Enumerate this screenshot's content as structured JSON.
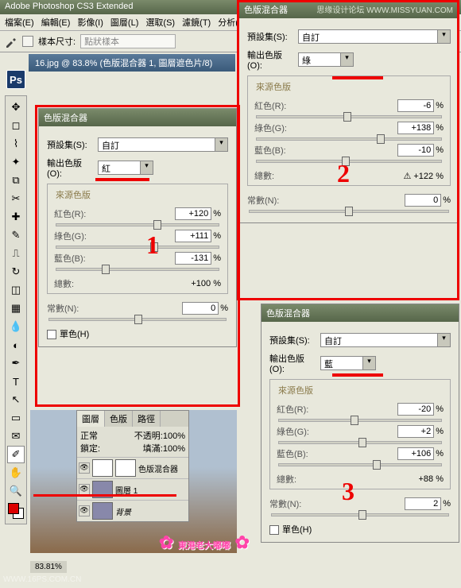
{
  "app": {
    "title": "Adobe Photoshop CS3 Extended"
  },
  "menu": {
    "file": "檔案(E)",
    "edit": "編輯(E)",
    "image": "影像(I)",
    "layer": "圖層(L)",
    "select": "選取(S)",
    "filter": "濾鏡(T)",
    "analysis": "分析(A)"
  },
  "toolbar": {
    "sample_size": "樣本尺寸:",
    "sample_value": "點狀樣本"
  },
  "doc": {
    "tab": "16.jpg @ 83.8% (色版混合器 1, 圖層遮色片/8)",
    "zoom": "83.81%"
  },
  "panels": {
    "title": "色版混合器",
    "preset_lbl": "預設集(S):",
    "preset_val": "自訂",
    "output_lbl": "輸出色版(O):",
    "source_lbl": "來源色版",
    "red_lbl": "紅色(R):",
    "green_lbl": "綠色(G):",
    "blue_lbl": "藍色(B):",
    "total_lbl": "總數:",
    "constant_lbl": "常數(N):",
    "mono_lbl": "單色(H)",
    "pct": "%"
  },
  "p1": {
    "output": "紅",
    "red": "+120",
    "green": "+111",
    "blue": "-131",
    "total": "+100",
    "constant": "0"
  },
  "p2": {
    "output": "綠",
    "red": "-6",
    "green": "+138",
    "blue": "-10",
    "total": "+122",
    "constant": "0"
  },
  "p3": {
    "output": "藍",
    "red": "-20",
    "green": "+2",
    "blue": "+106",
    "total": "+88",
    "constant": "2"
  },
  "layers": {
    "tab_layers": "圖層",
    "tab_channels": "色版",
    "tab_paths": "路徑",
    "mode": "正常",
    "opacity_lbl": "不透明:",
    "opacity": "100%",
    "lock_lbl": "鎖定:",
    "fill_lbl": "填滿:",
    "fill": "100%",
    "l1": "色版混合器",
    "l2": "圖層 1",
    "l3": "背景"
  },
  "wm": {
    "top": "思缘设计论坛  WWW.MISSYUAN.COM",
    "bottom": "WWW.16PS.COM.CN",
    "pink": "東港老大嘟嘟"
  },
  "annot": {
    "n1": "1",
    "n2": "2",
    "n3": "3"
  }
}
